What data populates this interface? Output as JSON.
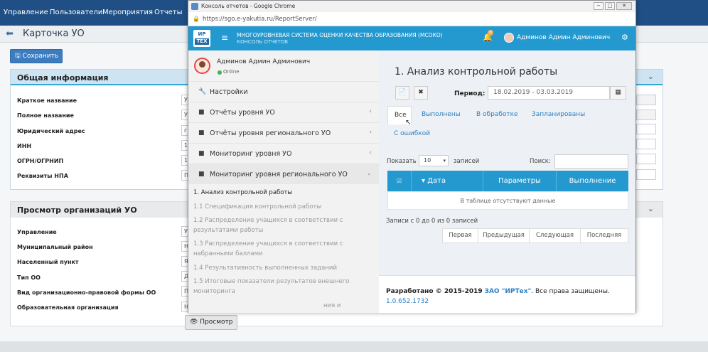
{
  "background": {
    "topnav": [
      "Управление",
      "Пользователи",
      "Мероприятия",
      "Отчеты"
    ],
    "page_title": "Карточка УО",
    "save_button": "Сохранить",
    "panel1": {
      "title": "Общая информация",
      "fields": [
        {
          "label": "Краткое название",
          "value": "У"
        },
        {
          "label": "Полное название",
          "value": "У"
        },
        {
          "label": "Юридический адрес",
          "value": "г"
        },
        {
          "label": "ИНН",
          "value": "1"
        },
        {
          "label": "ОГРН/ОГРНИП",
          "value": "1"
        },
        {
          "label": "Реквизиты НПА",
          "value": "П"
        }
      ]
    },
    "panel2": {
      "title": "Просмотр организаций УО",
      "fields": [
        {
          "label": "Управление",
          "value": "У"
        },
        {
          "label": "Муниципальный район",
          "value": "Н"
        },
        {
          "label": "Населенный пункт",
          "value": "Я"
        },
        {
          "label": "Тип ОО",
          "value": "Д"
        },
        {
          "label": "Вид организационно-правовой формы ОО",
          "value": "П"
        },
        {
          "label": "Образовательная организация",
          "value": "Н"
        }
      ]
    },
    "view_button": "Просмотр"
  },
  "window": {
    "title": "Консоль отчетов - Google Chrome",
    "url": "https://sgo.e-yakutia.ru/ReportServer/"
  },
  "app": {
    "logo_top": "ИР",
    "logo_bottom": "ТЕХ",
    "title": "МНОГОУРОВНЕВАЯ СИСТЕМА ОЦЕНКИ КАЧЕСТВА ОБРАЗОВАНИЯ (МСОКО)",
    "subtitle": "КОНСОЛЬ ОТЧЕТОВ",
    "notif_count": "0",
    "user": "Админов Админ Админович"
  },
  "sidebar": {
    "user_name": "Админов Админ Админович",
    "status": "Online",
    "items": [
      {
        "label": "Настройки",
        "icon": "wrench-icon"
      },
      {
        "label": "Отчёты уровня УО",
        "icon": "folder-icon"
      },
      {
        "label": "Отчёты уровня регионального УО",
        "icon": "folder-icon"
      },
      {
        "label": "Мониторинг уровня УО",
        "icon": "folder-icon"
      },
      {
        "label": "Мониторинг уровня регионального УО",
        "icon": "folder-icon"
      }
    ],
    "subitems": [
      "1. Анализ контрольной работы",
      "1.1 Спецификация контрольной работы",
      "1.2 Распределение учащихся в соответствии с",
      "результатами работы",
      "1.3 Распределение учащихся в соответствии с",
      "набранными баллами",
      "1.4 Результативность выполненных заданий",
      "1.5 Итоговые показатели результатов внешнего",
      "мониторинга",
      "ния и"
    ]
  },
  "main": {
    "report_title": "1. Анализ контрольной работы",
    "period_label": "Период:",
    "period_value": "18.02.2019 - 03.03.2019",
    "tabs": [
      "Все",
      "Выполнены",
      "В обработке",
      "Запланированы",
      "С ошибкой"
    ],
    "show_label": "Показать",
    "show_value": "10",
    "records_label": "записей",
    "search_label": "Поиск:",
    "columns": [
      "Дата",
      "Параметры",
      "Выполнение"
    ],
    "empty_text": "В таблице отсутствуют данные",
    "records_info": "Записи с 0 до 0 из 0 записей",
    "pager": [
      "Первая",
      "Предыдущая",
      "Следующая",
      "Последняя"
    ],
    "footer_dev_prefix": "Разработано © 2015-2019",
    "footer_company": "ЗАО \"ИРТех\"",
    "footer_rights": ". Все права защищены.",
    "version": "1.0.652.1732"
  }
}
